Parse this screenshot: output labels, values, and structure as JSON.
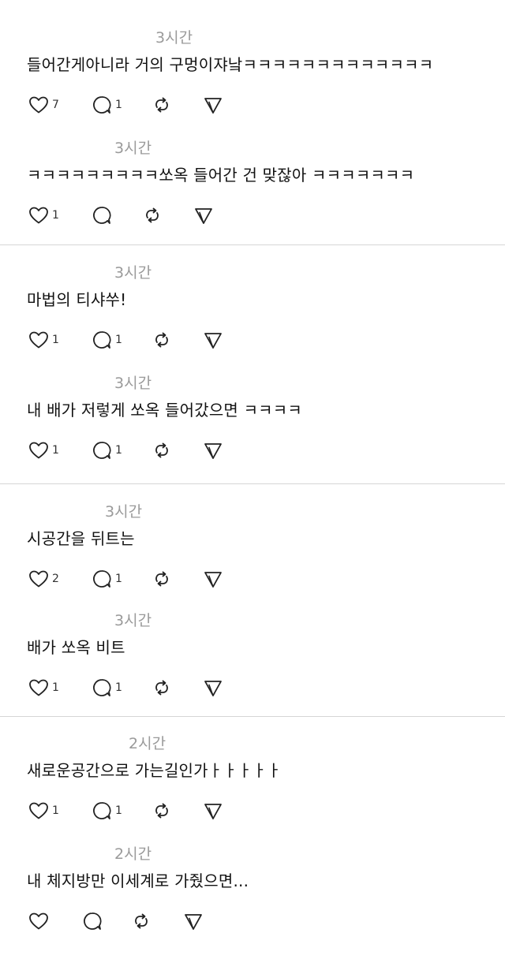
{
  "comments": [
    {
      "time": "3시간",
      "text": "들어간게아니라 거의 구멍이쟈낰ㅋㅋㅋㅋㅋㅋㅋㅋㅋㅋㅋㅋㅋ",
      "likes": "7",
      "replies": "1"
    },
    {
      "time": "3시간",
      "text": "ㅋㅋㅋㅋㅋㅋㅋㅋㅋ쏘옥 들어간 건 맞잖아 ㅋㅋㅋㅋㅋㅋㅋ",
      "likes": "1",
      "replies": ""
    },
    {
      "time": "3시간",
      "text": "마법의 티샤쑤!",
      "likes": "1",
      "replies": "1"
    },
    {
      "time": "3시간",
      "text": "내 배가 저렇게 쏘옥 들어갔으면 ㅋㅋㅋㅋ",
      "likes": "1",
      "replies": "1"
    },
    {
      "time": "3시간",
      "text": "시공간을 뒤트는",
      "likes": "2",
      "replies": "1"
    },
    {
      "time": "3시간",
      "text": "배가 쏘옥 비트",
      "likes": "1",
      "replies": "1"
    },
    {
      "time": "2시간",
      "text": "새로운공간으로 가는길인가ㅏㅏㅏㅏㅏ",
      "likes": "1",
      "replies": "1"
    },
    {
      "time": "2시간",
      "text": "내 체지방만 이세계로 가줬으면...",
      "likes": "",
      "replies": ""
    }
  ],
  "icons": {
    "like": "heart-icon",
    "reply": "comment-bubble-icon",
    "repost": "repost-arrows-icon",
    "share": "send-paper-plane-icon"
  },
  "colors": {
    "text": "#111111",
    "muted": "#9a9a9a",
    "icon": "#222222",
    "divider": "#d6d6d6"
  }
}
